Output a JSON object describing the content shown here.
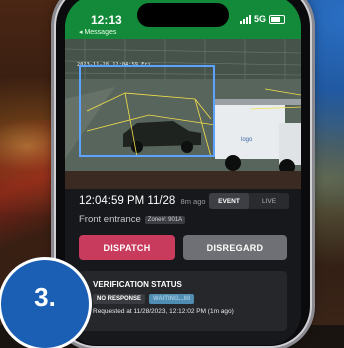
{
  "status_bar": {
    "time": "12:13",
    "back_label": "◂ Messages",
    "network": "5G"
  },
  "camera": {
    "overlay_timestamp": "2023-11-28 12:04:59 Fri",
    "detection_box_color": "#5ea2ff",
    "zone_line_color": "#f5e04a"
  },
  "event": {
    "time": "12:04:59 PM 11/28",
    "ago": "8m ago",
    "mode_tabs": [
      {
        "label": "EVENT",
        "active": true
      },
      {
        "label": "LIVE",
        "active": false
      }
    ],
    "location": "Front entrance",
    "zone": "Zone#: 901A"
  },
  "actions": {
    "dispatch_label": "DISPATCH",
    "disregard_label": "DISREGARD",
    "dispatch_color": "#c93b5c",
    "disregard_color": "#6f7075"
  },
  "verification": {
    "title": "VERIFICATION STATUS",
    "response_badge": "NO RESPONSE",
    "waiting_badge": "WAITING...60",
    "requested_text": "Requested at 11/28/2023, 12:12:02 PM (1m ago)"
  },
  "step_badge": {
    "label": "3.",
    "color": "#1a5fb4"
  }
}
